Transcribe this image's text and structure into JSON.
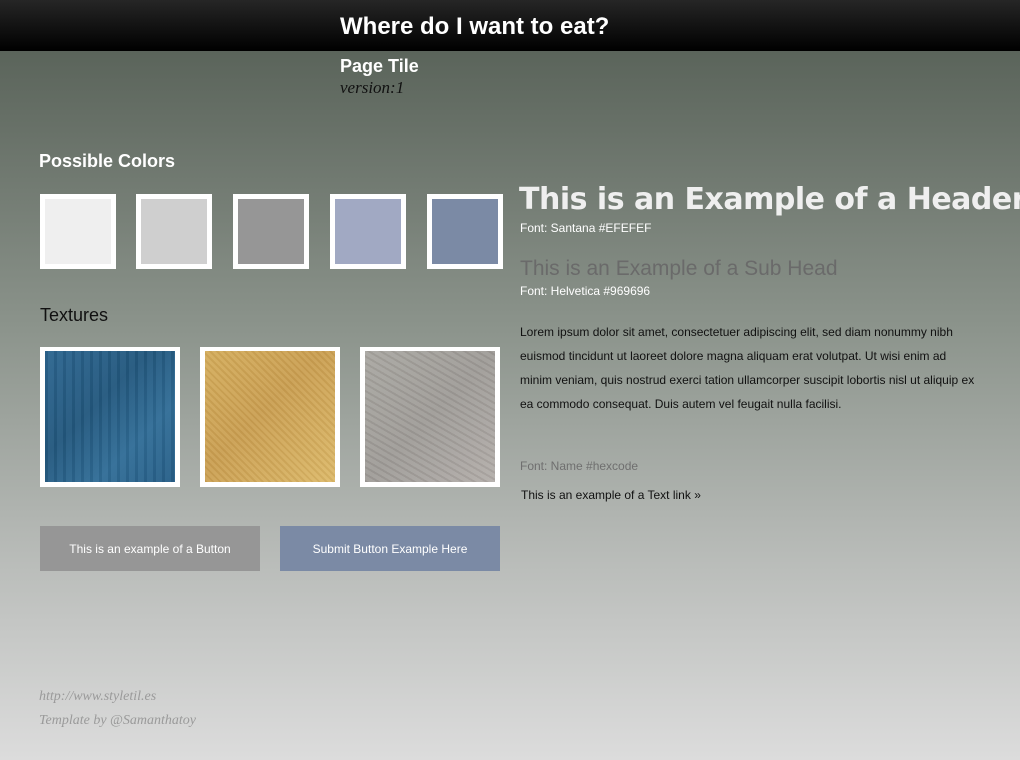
{
  "header": {
    "title": "Where do I want to eat?"
  },
  "page": {
    "title": "Page Tile",
    "version": "version:1"
  },
  "colors": {
    "label": "Possible Colors",
    "swatches": [
      "#efefef",
      "#cfcfcf",
      "#969696",
      "#a1a9c3",
      "#7b8aa5"
    ]
  },
  "textures": {
    "label": "Textures",
    "items": [
      "blue-watercolor-texture",
      "sand-texture",
      "stone-texture"
    ]
  },
  "buttons": {
    "example": "This is an example of a Button",
    "submit": "Submit Button Example Here"
  },
  "typography": {
    "header_example": "This is an Example of a Header",
    "header_font_note": "Font: Santana #EFEFEF",
    "subhead_example": "This is an Example of a Sub Head",
    "subhead_font_note": "Font: Helvetica #969696",
    "body_text": "Lorem ipsum dolor sit amet, consectetuer adipiscing elit, sed diam nonummy nibh euismod tincidunt ut laoreet dolore magna aliquam erat volutpat. Ut wisi enim ad minim veniam, quis nostrud exerci tation ullamcorper suscipit lobortis nisl ut aliquip ex ea commodo consequat. Duis autem vel feugait nulla facilisi.",
    "font_name_note": "Font: Name #hexcode",
    "text_link": "This is an example of a Text link »"
  },
  "footer": {
    "url": "http://www.styletil.es",
    "credit": "Template by @Samanthatoy"
  }
}
